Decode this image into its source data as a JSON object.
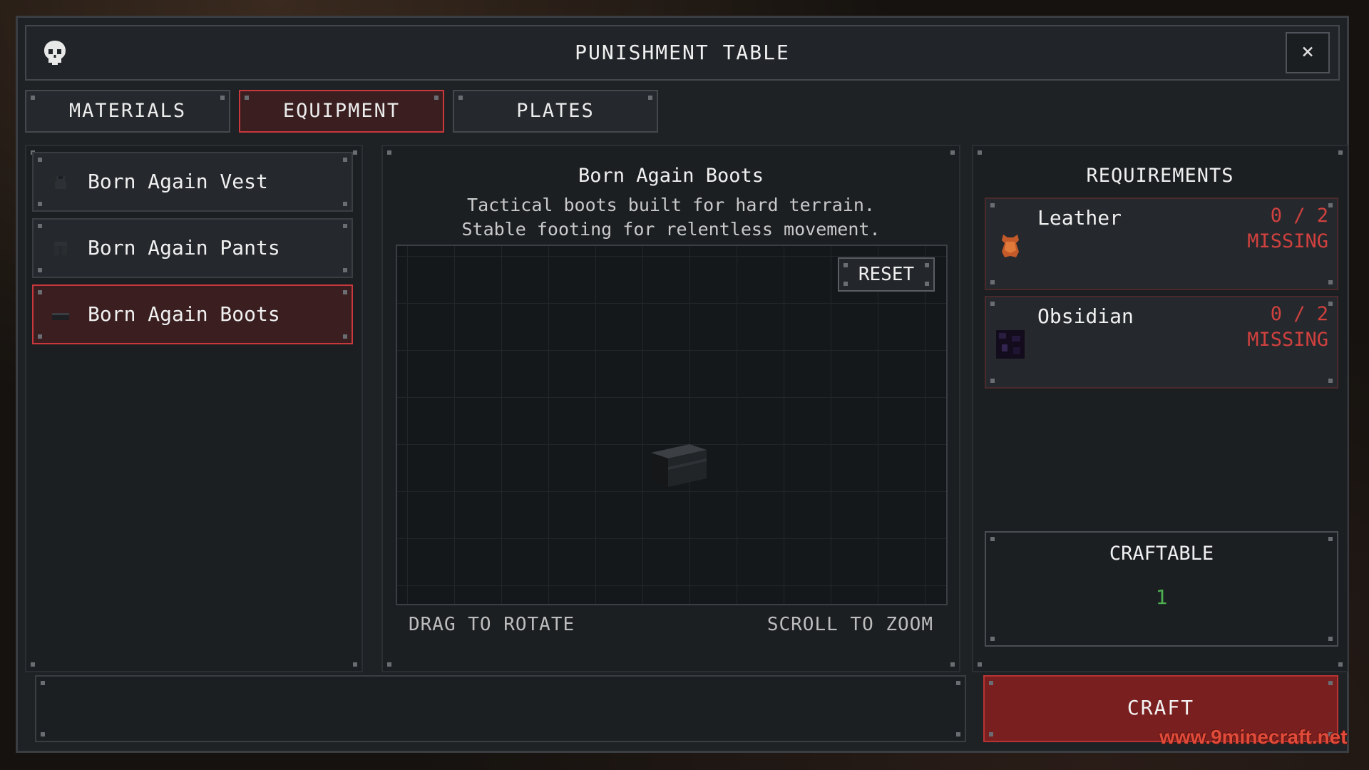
{
  "window": {
    "title": "PUNISHMENT TABLE",
    "close_label": "×"
  },
  "tabs": [
    {
      "label": "MATERIALS",
      "active": false
    },
    {
      "label": "EQUIPMENT",
      "active": true
    },
    {
      "label": "PLATES",
      "active": false
    }
  ],
  "equipment_list": [
    {
      "label": "Born Again Vest",
      "icon": "vest-icon",
      "selected": false
    },
    {
      "label": "Born Again Pants",
      "icon": "pants-icon",
      "selected": false
    },
    {
      "label": "Born Again Boots",
      "icon": "boots-icon",
      "selected": true
    }
  ],
  "preview": {
    "title": "Born Again Boots",
    "description_line1": "Tactical boots built for hard terrain.",
    "description_line2": "Stable footing for relentless movement.",
    "reset_label": "RESET",
    "hint_left": "DRAG TO ROTATE",
    "hint_right": "SCROLL TO ZOOM"
  },
  "requirements": {
    "title": "REQUIREMENTS",
    "items": [
      {
        "name": "Leather",
        "count": "0 / 2",
        "status": "MISSING",
        "icon": "leather-icon"
      },
      {
        "name": "Obsidian",
        "count": "0 / 2",
        "status": "MISSING",
        "icon": "obsidian-icon"
      }
    ],
    "craftable_label": "CRAFTABLE",
    "craftable_count": "1"
  },
  "craft_button": "CRAFT",
  "watermark": "www.9minecraft.net",
  "colors": {
    "accent_red": "#c8383c",
    "missing": "#d0413f",
    "craftable_green": "#4caf50",
    "craft_button_bg": "#7a1f1f"
  }
}
